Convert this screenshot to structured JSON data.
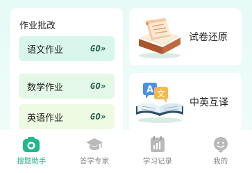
{
  "homework": {
    "title": "作业批改",
    "go_label": "GO»",
    "items": [
      {
        "label": "语文作业"
      },
      {
        "label": "数学作业"
      },
      {
        "label": "英语作业"
      }
    ]
  },
  "tools": [
    {
      "label": "试卷还原",
      "icon": "exam-paper-icon"
    },
    {
      "label": "中英互译",
      "icon": "translate-book-icon"
    }
  ],
  "tabbar": {
    "active": 0,
    "items": [
      {
        "label": "搜题助手",
        "icon": "camera-icon"
      },
      {
        "label": "答学专家",
        "icon": "graduation-cap-icon"
      },
      {
        "label": "学习记录",
        "icon": "records-icon"
      },
      {
        "label": "我的",
        "icon": "profile-icon"
      }
    ]
  },
  "colors": {
    "accent": "#22b98a",
    "inactive": "#888888"
  }
}
